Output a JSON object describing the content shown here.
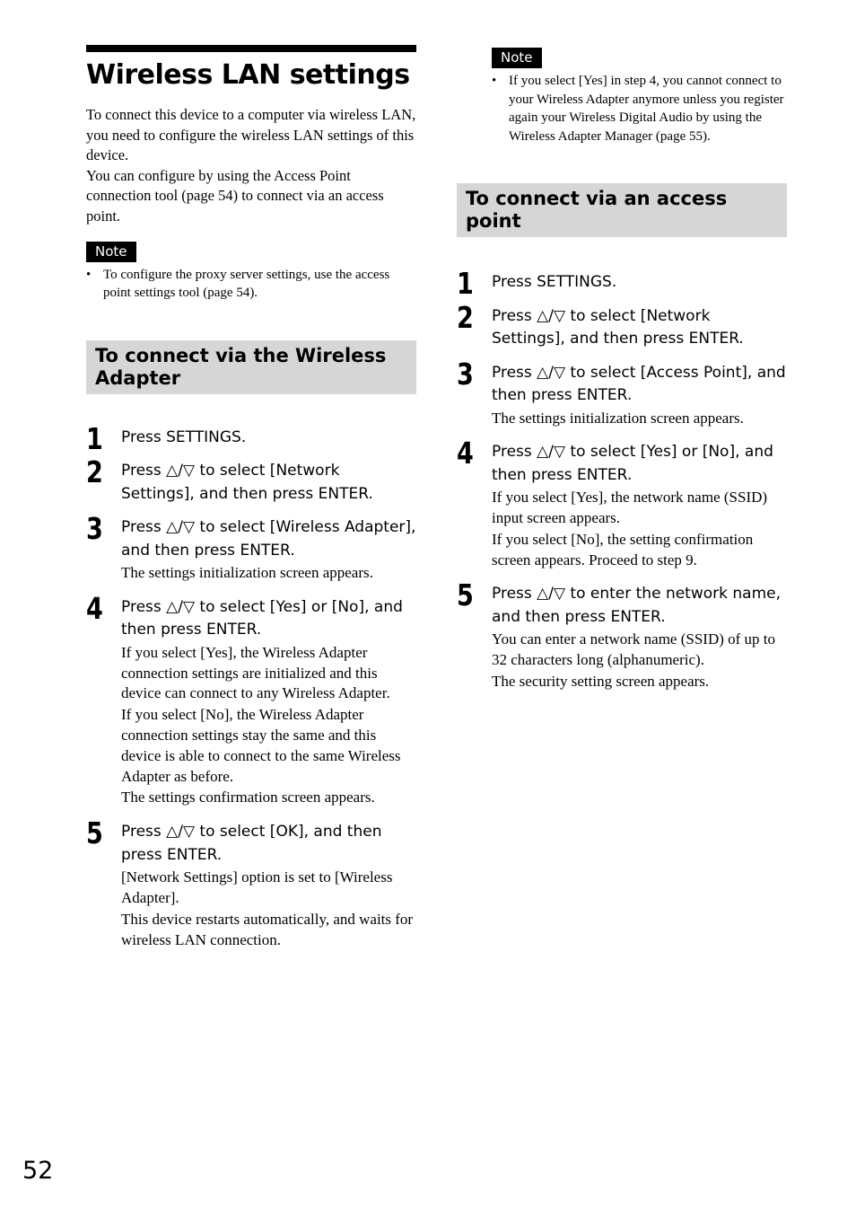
{
  "page": {
    "title": "Wireless LAN settings",
    "page_number": "52",
    "intro": [
      "To connect this device to a computer via wireless LAN, you need to configure the wireless LAN settings of this device.",
      "You can configure by using the Access Point connection tool (page 54) to connect via an access point."
    ],
    "note1": {
      "label": "Note",
      "bullet": "•",
      "items": [
        "To configure the proxy server settings, use the access point settings tool (page 54)."
      ]
    },
    "section_adapter": {
      "heading": "To connect via the Wireless Adapter",
      "steps": [
        {
          "num": "1",
          "instruction": "Press SETTINGS.",
          "details": []
        },
        {
          "num": "2",
          "instruction": "Press △/▽ to select [Network Settings], and then press ENTER.",
          "details": []
        },
        {
          "num": "3",
          "instruction": "Press △/▽ to select [Wireless Adapter], and then press ENTER.",
          "details": [
            "The settings initialization screen appears."
          ]
        },
        {
          "num": "4",
          "instruction": "Press △/▽ to select [Yes] or [No], and then press ENTER.",
          "details": [
            "If you select [Yes], the Wireless Adapter connection settings are initialized and this device can connect to any Wireless Adapter.",
            "If you select [No], the Wireless Adapter connection settings stay the same and this device is able to connect to the same Wireless Adapter as before.",
            "The settings confirmation screen appears."
          ]
        },
        {
          "num": "5",
          "instruction": "Press △/▽ to select [OK], and then press ENTER.",
          "details": [
            "[Network Settings] option is set to [Wireless Adapter].",
            "This device restarts automatically, and waits for wireless LAN connection."
          ]
        }
      ]
    },
    "note2": {
      "label": "Note",
      "bullet": "•",
      "items": [
        "If you select [Yes] in step 4, you cannot connect to your Wireless Adapter anymore unless you register again your Wireless Digital Audio by using the Wireless Adapter Manager (page 55)."
      ]
    },
    "section_access_point": {
      "heading": "To connect via an access point",
      "steps": [
        {
          "num": "1",
          "instruction": "Press SETTINGS.",
          "details": []
        },
        {
          "num": "2",
          "instruction": "Press △/▽ to select [Network Settings], and then press ENTER.",
          "details": []
        },
        {
          "num": "3",
          "instruction": "Press △/▽ to select [Access Point], and then press ENTER.",
          "details": [
            "The settings initialization screen appears."
          ]
        },
        {
          "num": "4",
          "instruction": "Press △/▽ to select [Yes] or [No], and then press ENTER.",
          "details": [
            "If you select [Yes], the network name (SSID) input screen appears.",
            "If you select [No], the setting confirmation screen appears. Proceed to step 9."
          ]
        },
        {
          "num": "5",
          "instruction": "Press △/▽ to enter the network name, and then press ENTER.",
          "details": [
            "You can enter a network name (SSID) of up to 32 characters long (alphanumeric).",
            "The security setting screen appears."
          ]
        }
      ]
    }
  }
}
